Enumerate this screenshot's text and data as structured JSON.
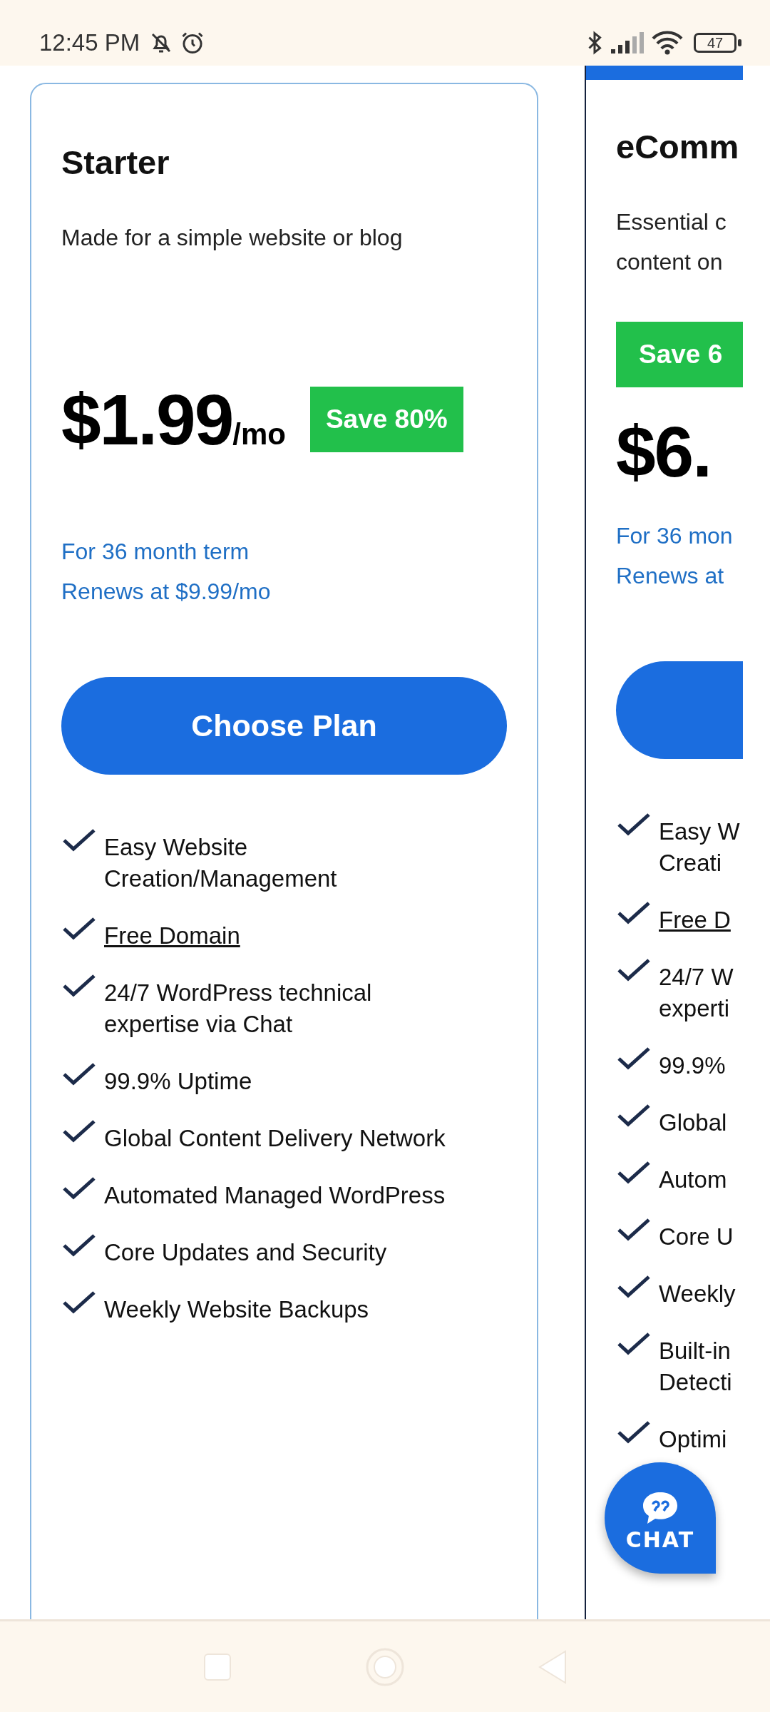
{
  "status_bar": {
    "time": "12:45 PM",
    "battery": "47"
  },
  "plans": [
    {
      "title": "Starter",
      "highlighted": false,
      "description": "Made for a simple website or blog",
      "badge_first": false,
      "price": "$1.99",
      "unit": "/mo",
      "badge": "Save 80%",
      "term": "For 36 month term",
      "renewal": "Renews at $9.99/mo",
      "button": "Choose Plan",
      "features": [
        {
          "text": "Easy Website Creation/Management",
          "link": false
        },
        {
          "text": "Free Domain",
          "link": true
        },
        {
          "text": "24/7 WordPress technical expertise via Chat",
          "link": false
        },
        {
          "text": "99.9% Uptime",
          "link": false
        },
        {
          "text": "Global Content Delivery Network",
          "link": false
        },
        {
          "text": "Automated Managed WordPress",
          "link": false
        },
        {
          "text": "Core Updates and Security",
          "link": false
        },
        {
          "text": "Weekly Website Backups",
          "link": false
        }
      ]
    },
    {
      "title": "eComm",
      "highlighted": true,
      "description": "Essential c\ncontent on",
      "badge_first": true,
      "price": "$6.",
      "badge": "Save 6",
      "term": "For 36 mon",
      "renewal": "Renews at",
      "features": [
        {
          "text": "Easy W\nCreati",
          "link": false
        },
        {
          "text": "Free D",
          "link": true
        },
        {
          "text": "24/7 W\nexperti",
          "link": false
        },
        {
          "text": "99.9%",
          "link": false
        },
        {
          "text": "Global",
          "link": false
        },
        {
          "text": "Autom",
          "link": false
        },
        {
          "text": "Core U",
          "link": false
        },
        {
          "text": "Weekly",
          "link": false
        },
        {
          "text": "Built-in\nDetecti",
          "link": false
        },
        {
          "text": "Optimi",
          "link": false
        }
      ]
    }
  ],
  "chat": {
    "label": "CHAT"
  }
}
